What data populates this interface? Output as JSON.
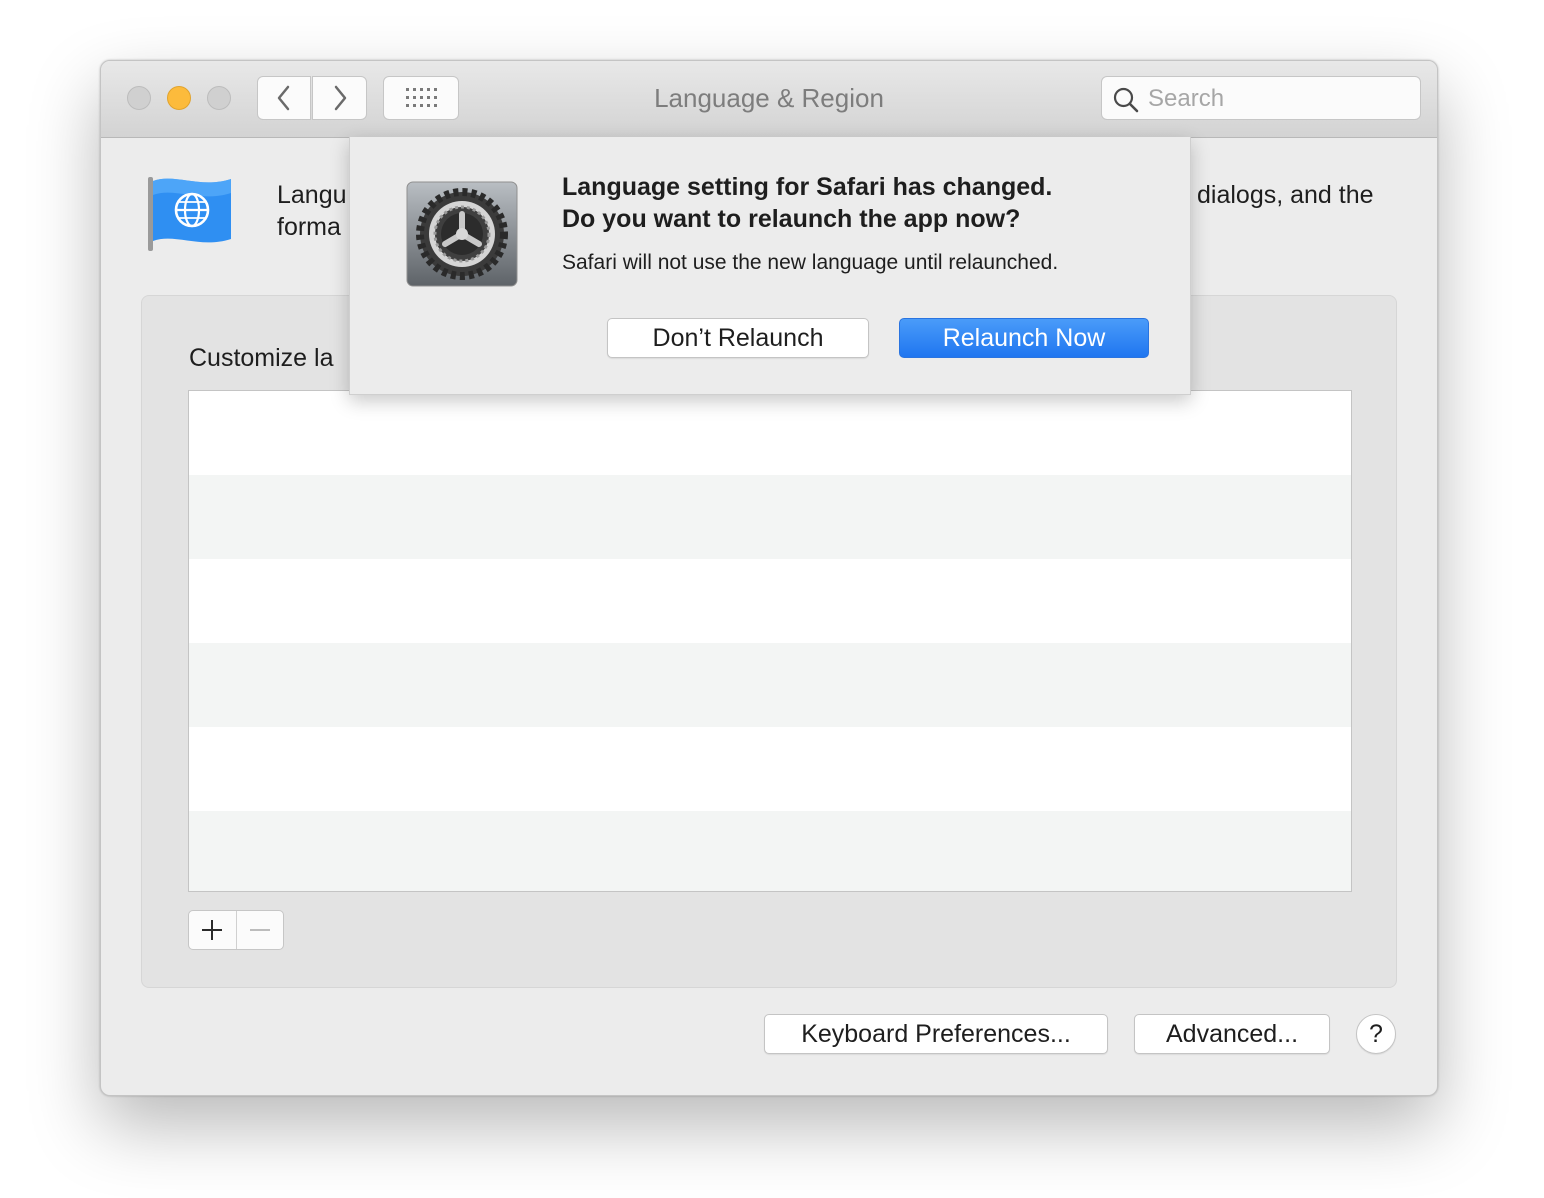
{
  "window": {
    "title": "Language & Region",
    "search_placeholder": "Search"
  },
  "main": {
    "description_start_line1": "Langu",
    "description_start_line2": "forma",
    "description_end_line1": "dialogs, and the",
    "group_label": "Customize la",
    "list_rows": 6
  },
  "buttons": {
    "keyboard": "Keyboard Preferences...",
    "advanced": "Advanced...",
    "help": "?"
  },
  "dialog": {
    "title_line1": "Language setting for Safari has changed.",
    "title_line2": "Do you want to relaunch the app now?",
    "message": "Safari will not use the new language until relaunched.",
    "secondary_button": "Don’t Relaunch",
    "primary_button": "Relaunch Now"
  },
  "colors": {
    "accent": "#1f76f0",
    "minimize": "#fcbb3c",
    "flag": "#2f8ff2"
  }
}
